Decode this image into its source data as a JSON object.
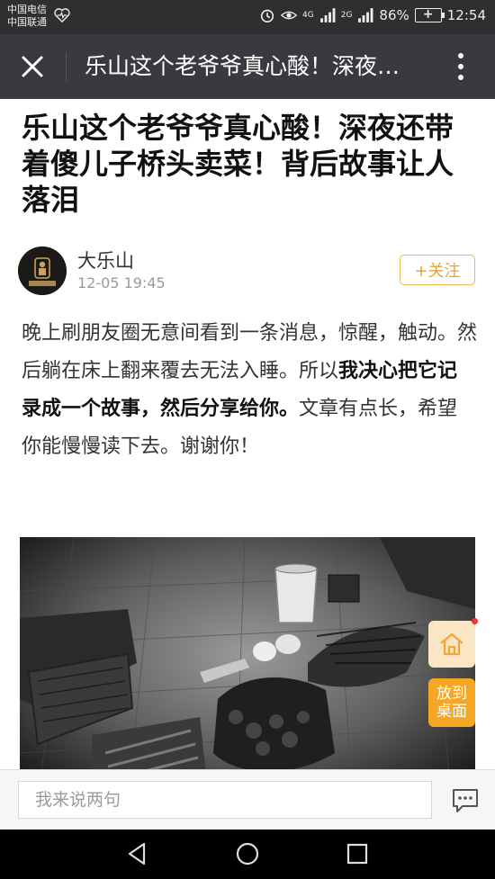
{
  "status_bar": {
    "carrier_1": "中国电信",
    "carrier_2": "中国联通",
    "network_1": "4G",
    "network_2": "2G",
    "battery": "86%",
    "time": "12:54"
  },
  "navbar": {
    "title": "乐山这个老爷爷真心酸！深夜…",
    "close_icon": "close-icon",
    "more_icon": "more-vertical-icon"
  },
  "article": {
    "headline": "乐山这个老爷爷真心酸！深夜还带着傻儿子桥头卖菜！背后故事让人落泪",
    "author": "大乐山",
    "date": "12-05 19:45",
    "follow_label": "+关注",
    "para_1": "晚上刷朋友圈无意间看到一条消息，惊醒，触动。然后躺在床上翻来覆去无法入睡。所以",
    "para_bold": "我决心把它记录成一个故事，然后分享给你。",
    "para_2": "文章有点长，希望你能慢慢读下去。谢谢你！"
  },
  "floating": {
    "desktop_label_1": "放到",
    "desktop_label_2": "桌面"
  },
  "comment": {
    "placeholder": "我来说两句"
  },
  "colors": {
    "navbar": "#393a3f",
    "follow_accent": "#f0b34d",
    "desktop_button": "#f5a623"
  }
}
